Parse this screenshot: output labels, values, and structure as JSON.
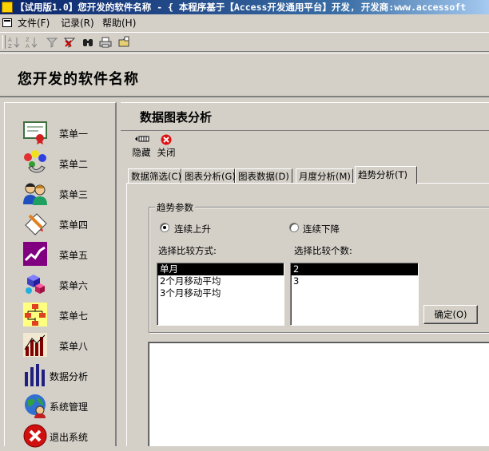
{
  "window": {
    "title": "【试用版1.0】您开发的软件名称 - { 本程序基于【Access开发通用平台】开发, 开发商:www.accessoft"
  },
  "menubar": {
    "items": [
      {
        "label": "文件(F)"
      },
      {
        "label": "记录(R)"
      },
      {
        "label": "帮助(H)"
      }
    ]
  },
  "toolbar": {
    "buttons": [
      {
        "icon": "sort-ascending-icon"
      },
      {
        "icon": "sort-descending-icon"
      },
      {
        "icon": "filter-icon"
      },
      {
        "icon": "remove-filter-icon"
      },
      {
        "icon": "find-icon"
      },
      {
        "icon": "print-icon"
      },
      {
        "icon": "open-folder-icon"
      }
    ]
  },
  "header": {
    "app_name": "您开发的软件名称"
  },
  "sidebar": {
    "items": [
      {
        "label": "菜单一",
        "icon": "certificate-icon"
      },
      {
        "label": "菜单二",
        "icon": "shapes-icon"
      },
      {
        "label": "菜单三",
        "icon": "people-icon"
      },
      {
        "label": "菜单四",
        "icon": "document-pen-icon"
      },
      {
        "label": "菜单五",
        "icon": "line-chart-icon"
      },
      {
        "label": "菜单六",
        "icon": "cubes-icon"
      },
      {
        "label": "菜单七",
        "icon": "org-chart-icon"
      },
      {
        "label": "菜单八",
        "icon": "bar-chart-icon"
      },
      {
        "label": "数据分析",
        "icon": "bars-icon"
      },
      {
        "label": "系统管理",
        "icon": "globe-user-icon"
      },
      {
        "label": "退出系统",
        "icon": "exit-icon"
      }
    ]
  },
  "main": {
    "title": "数据图表分析",
    "actions": [
      {
        "label": "隐藏",
        "icon": "hide-icon"
      },
      {
        "label": "关闭",
        "icon": "close-icon"
      }
    ],
    "tabs": [
      {
        "label": "数据筛选(C)",
        "active": false
      },
      {
        "label": "图表分析(G)",
        "active": false
      },
      {
        "label": "图表数据(D)",
        "active": false
      },
      {
        "label": "月度分析(M)",
        "active": false
      },
      {
        "label": "趋势分析(T)",
        "active": true
      }
    ],
    "trend": {
      "group_title": "趋势参数",
      "option_up": "连续上升",
      "option_down": "连续下降",
      "selected_option": "连续上升",
      "method_label": "选择比较方式:",
      "methods": [
        "单月",
        "2个月移动平均",
        "3个月移动平均"
      ],
      "selected_method": "单月",
      "count_label": "选择比较个数:",
      "counts": [
        "2",
        "3"
      ],
      "selected_count": "2",
      "ok_label": "确定(O)"
    }
  },
  "colors": {
    "face": "#d4d0c8",
    "title_gradient_start": "#0a246a",
    "title_gradient_end": "#a6caf0",
    "selection": "#000000"
  }
}
